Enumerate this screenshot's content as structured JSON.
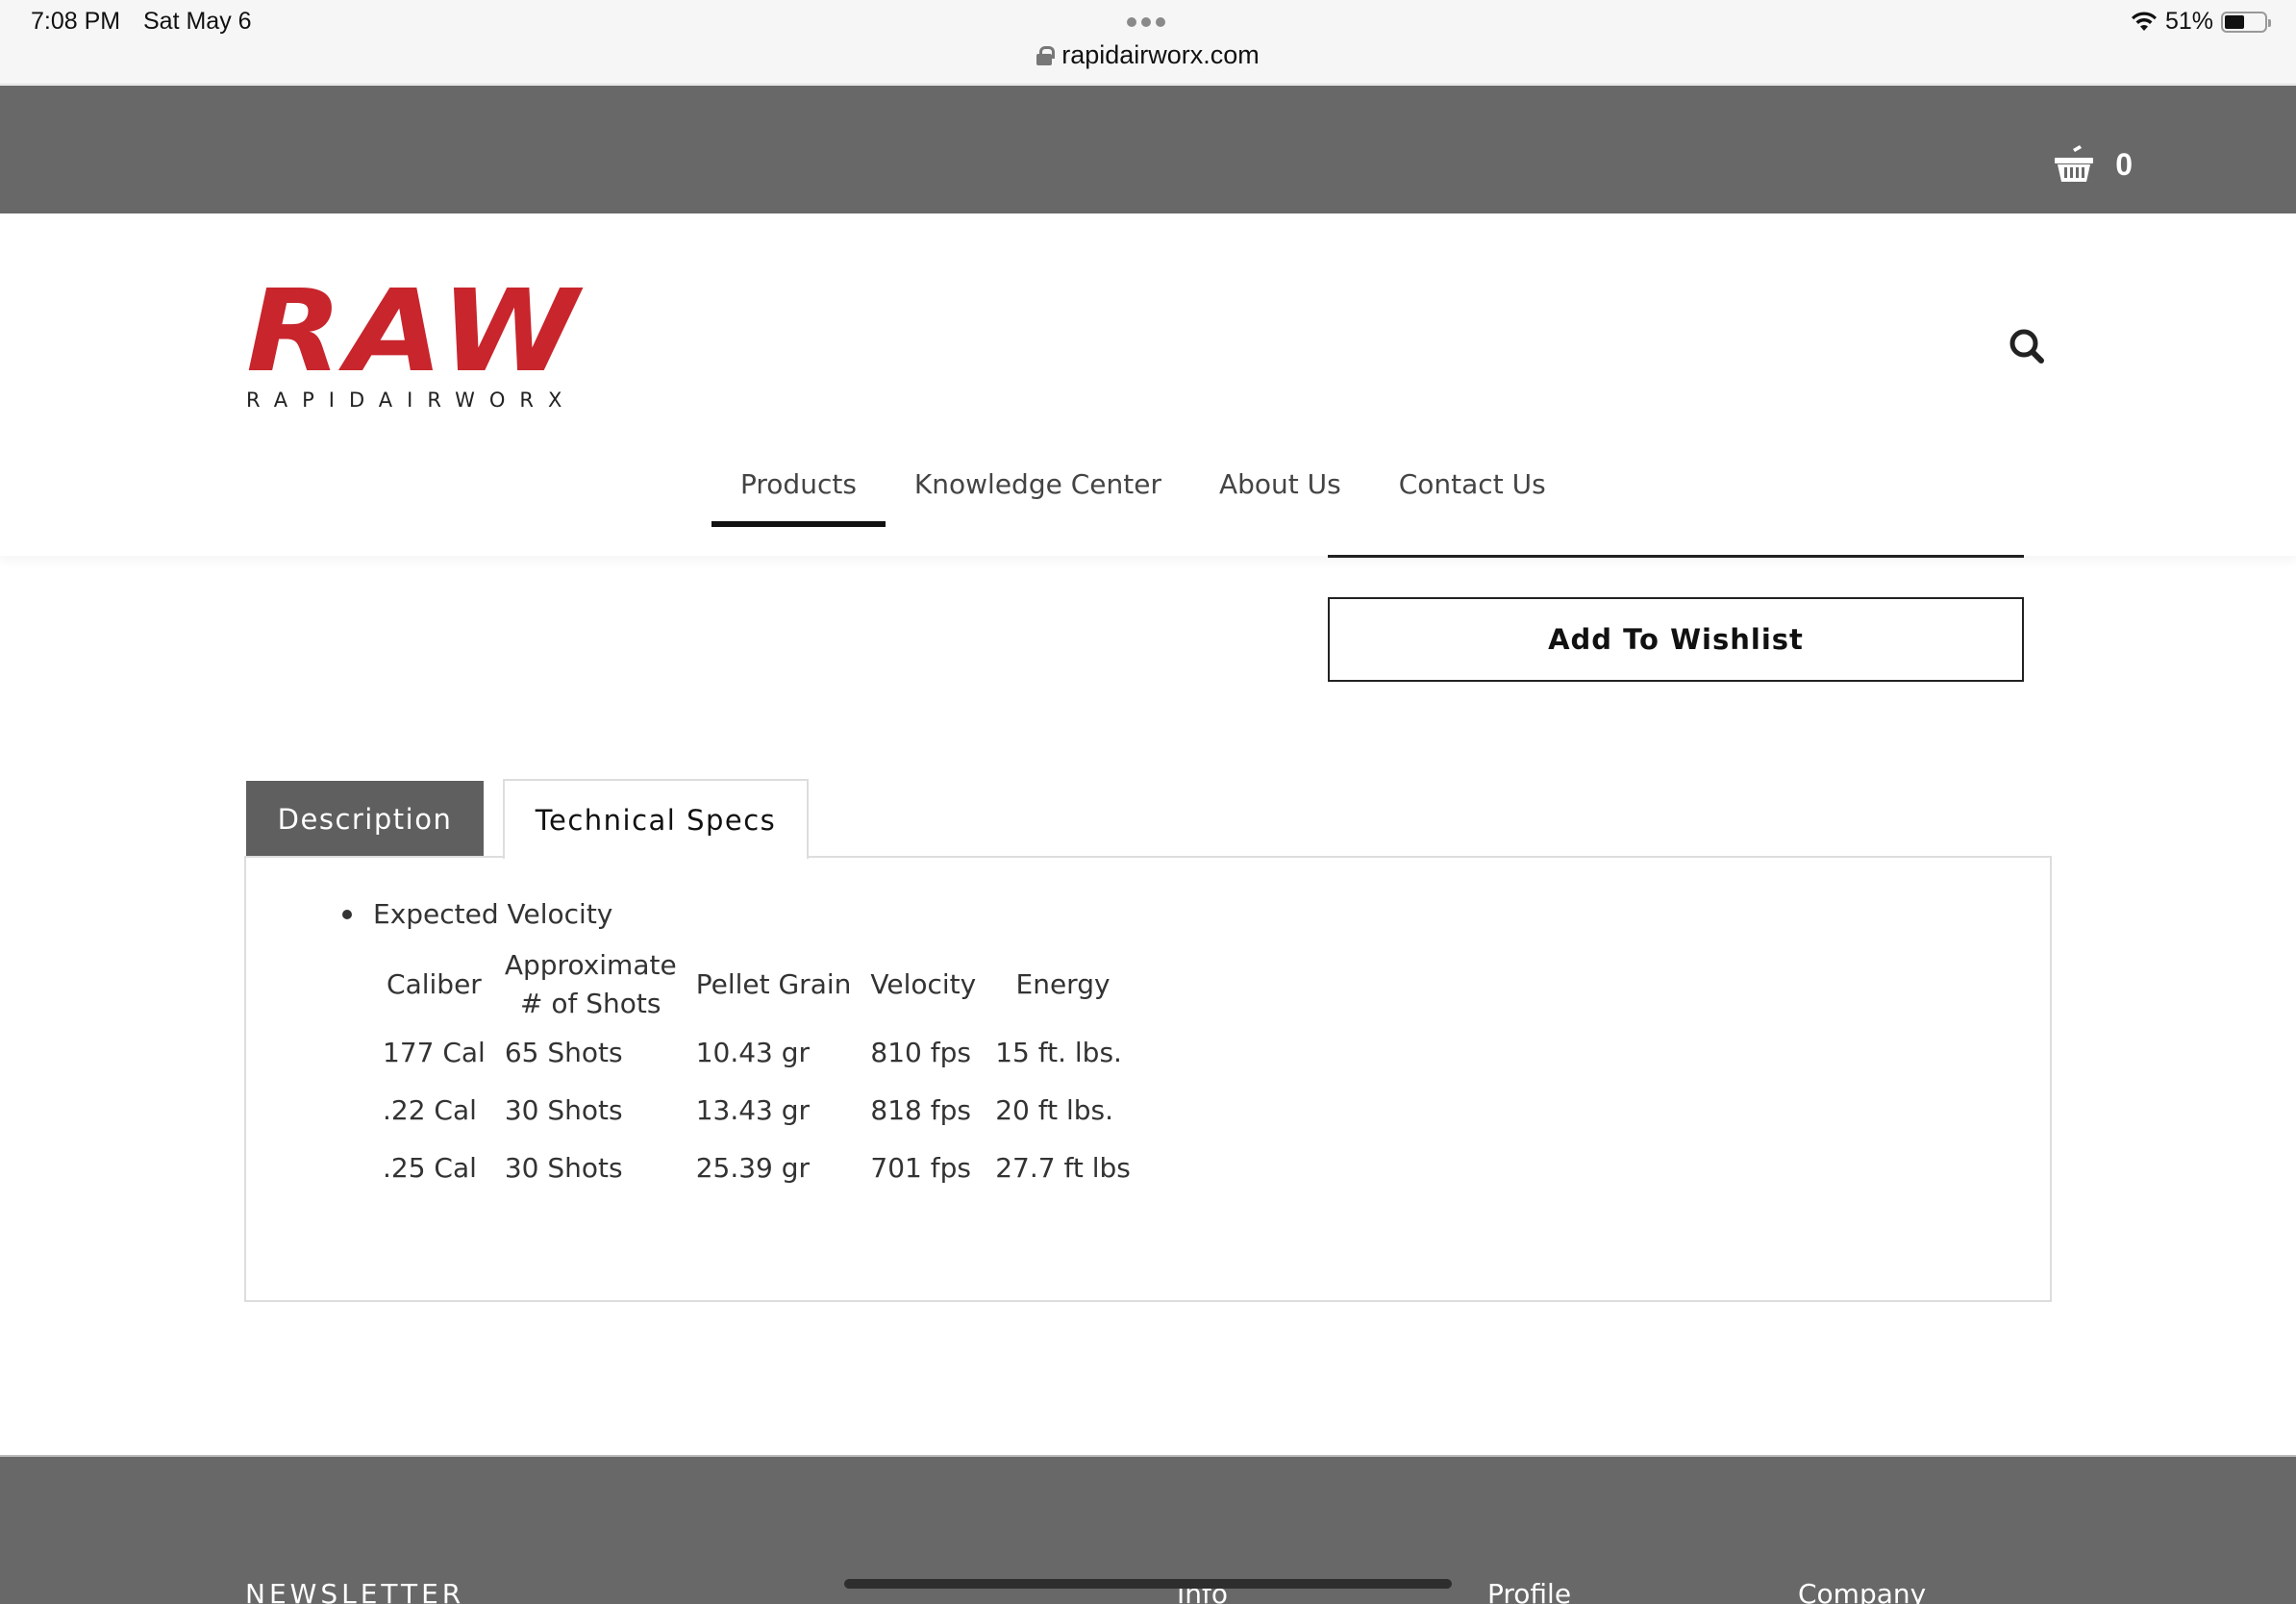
{
  "status_bar": {
    "time": "7:08 PM",
    "date": "Sat May 6",
    "url": "rapidairworx.com",
    "battery": "51%",
    "battery_level": 0.51
  },
  "top_bar": {
    "cart_icon": "basket-icon",
    "cart_count": "0"
  },
  "header": {
    "logo_main": "RAW",
    "logo_sub": "RAPIDAIRWORX",
    "search_icon": "search-icon",
    "nav": [
      {
        "label": "Products",
        "active": true
      },
      {
        "label": "Knowledge Center",
        "active": false
      },
      {
        "label": "About Us",
        "active": false
      },
      {
        "label": "Contact Us",
        "active": false
      }
    ]
  },
  "product": {
    "wishlist_label": "Add To Wishlist"
  },
  "tabs": [
    {
      "label": "Description",
      "active": false
    },
    {
      "label": "Technical Specs",
      "active": true
    }
  ],
  "specs": {
    "bullet": "Expected Velocity",
    "headers": [
      "Caliber",
      "Approximate # of Shots",
      "Pellet Grain",
      "Velocity",
      "Energy"
    ],
    "rows": [
      [
        "177 Cal",
        "65 Shots",
        "10.43 gr",
        "810 fps",
        "15 ft. lbs."
      ],
      [
        ".22 Cal",
        "30 Shots",
        "13.43 gr",
        "818 fps",
        "20 ft lbs."
      ],
      [
        ".25 Cal",
        "30 Shots",
        "25.39 gr",
        "701 fps",
        "27.7 ft lbs"
      ]
    ]
  },
  "footer": {
    "newsletter": "NEWSLETTER",
    "info": "Info",
    "profile": "Profile",
    "company": "Company"
  },
  "colors": {
    "brand_red": "#c8252c",
    "bar_grey": "#686868",
    "tab_grey": "#5f5f5f"
  }
}
